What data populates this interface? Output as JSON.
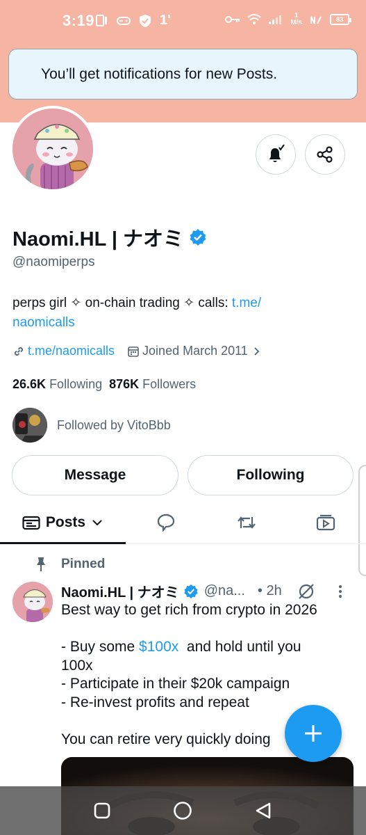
{
  "status_bar": {
    "time": "3:19",
    "net_speed_value": "1",
    "net_speed_unit": "M/s",
    "battery": "83",
    "signal_label": "1'"
  },
  "toast": {
    "text": "You’ll get notifications for new Posts."
  },
  "profile": {
    "display_name": "Naomi.HL | ナオミ",
    "handle": "@naomiperps",
    "bio_text": "perps girl ✧ on-chain trading ✧ calls: ",
    "bio_link_line1": "t.me/",
    "bio_link_line2": "naomicalls",
    "website": "t.me/naomicalls",
    "joined": "Joined March 2011",
    "following_count": "26.6K",
    "following_label": "Following",
    "followers_count": "876K",
    "followers_label": "Followers",
    "followed_by": "Followed by VitoBbb"
  },
  "buttons": {
    "message": "Message",
    "following": "Following"
  },
  "tabs": {
    "posts": "Posts"
  },
  "post": {
    "pinned_label": "Pinned",
    "author": "Naomi.HL | ナオミ",
    "handle": "@na...",
    "time": "• 2h",
    "line1": "Best way to get rich from crypto in 2026",
    "line2_prefix": "- Buy some ",
    "line2_link": "$100x",
    "line2_suffix": "  and hold until you",
    "line3": "100x",
    "line4": "- Participate in their $20k campaign",
    "line5": "- Re-invest profits and repeat",
    "line6": "You can retire very quickly doing"
  },
  "colors": {
    "accent": "#1d9bf0",
    "banner": "#f6b4a2",
    "secondary_text": "#536471"
  }
}
